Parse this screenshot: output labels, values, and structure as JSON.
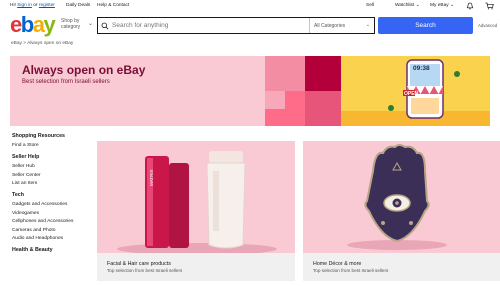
{
  "topbar": {
    "hi": "Hi!",
    "sign_in": "Sign in",
    "or": "or",
    "register": "register",
    "daily_deals": "Daily Deals",
    "help_contact": "Help & Contact",
    "sell": "Sell",
    "watchlist": "Watchlist",
    "my_ebay": "My eBay"
  },
  "header": {
    "logo": {
      "e": "e",
      "b": "b",
      "a": "a",
      "y": "y"
    },
    "shop_by_category": "Shop by category",
    "search_placeholder": "Search for anything",
    "category_select": "All Categories",
    "search_button": "Search",
    "advanced": "Advanced"
  },
  "breadcrumb": {
    "home": "eBay",
    "separator": ">",
    "current": "Always open on eBay"
  },
  "banner": {
    "title": "Always open on eBay",
    "subtitle": "Best selection from Israeli sellers",
    "phone_time": "09:38",
    "open_sign": "OPEN"
  },
  "sidebar": {
    "sections": [
      {
        "heading": "Shopping Resources",
        "items": [
          "Find a Store"
        ]
      },
      {
        "heading": "Seller Help",
        "items": [
          "Seller Hub",
          "Seller Center",
          "List an Item"
        ]
      },
      {
        "heading": "Tech",
        "items": [
          "Gadgets and Accessories",
          "Videogames",
          "Cellphones and Accessories",
          "Cameras and Photo",
          "Audio and Headphones"
        ]
      },
      {
        "heading": "Health & Beauty",
        "items": []
      }
    ]
  },
  "cards": [
    {
      "title": "Facial & Hair care products",
      "subtitle": "Top selection from best Israeli sellers",
      "product_text": "MATRIX"
    },
    {
      "title": "Home Décor & more",
      "subtitle": "Top selection from best Israeli sellers"
    }
  ],
  "colors": {
    "ebay_red": "#e53238",
    "ebay_blue": "#0064d2",
    "ebay_yellow": "#f5af02",
    "ebay_green": "#86b817",
    "search_button": "#3665f3",
    "banner_pink": "#f9c9d4",
    "banner_text": "#7a0e35"
  }
}
